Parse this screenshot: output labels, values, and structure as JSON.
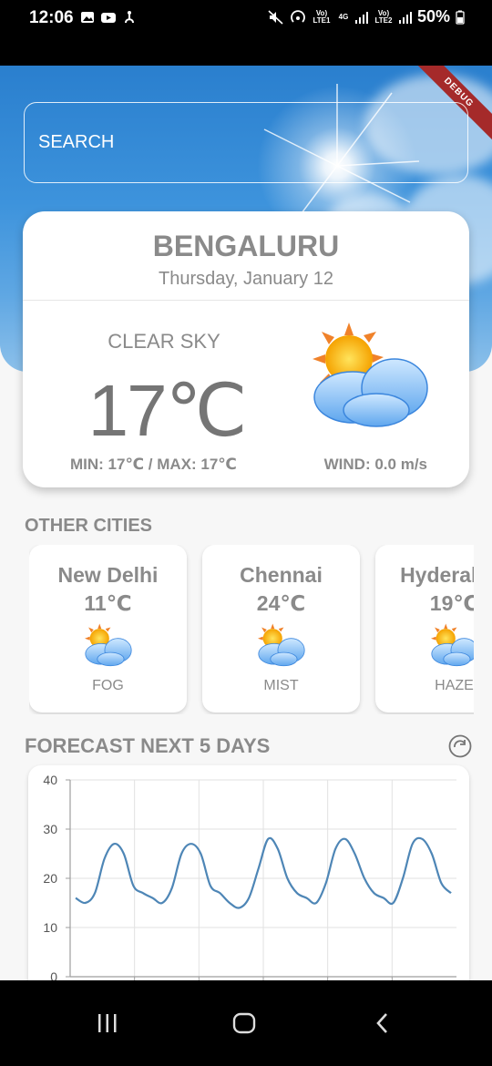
{
  "status_bar": {
    "time": "12:06",
    "battery": "50%",
    "network_1": "Vo) LTE1",
    "network_type": "4G",
    "network_2": "Vo) LTE2"
  },
  "debug_banner": "DEBUG",
  "search": {
    "placeholder": "SEARCH"
  },
  "current": {
    "city": "BENGALURU",
    "date": "Thursday, January 12",
    "condition": "CLEAR SKY",
    "temperature": "17℃",
    "min_max": "MIN: 17℃ / MAX: 17℃",
    "wind": "WIND: 0.0 m/s",
    "icon": "partly-cloudy-icon"
  },
  "other_cities": {
    "title": "OTHER CITIES",
    "items": [
      {
        "name": "New Delhi",
        "temp": "11℃",
        "condition": "FOG",
        "icon": "partly-cloudy-icon"
      },
      {
        "name": "Chennai",
        "temp": "24℃",
        "condition": "MIST",
        "icon": "partly-cloudy-icon"
      },
      {
        "name": "Hyderabad",
        "temp": "19℃",
        "condition": "HAZE",
        "icon": "partly-cloudy-icon"
      }
    ]
  },
  "forecast": {
    "title": "FORECAST NEXT 5 DAYS",
    "refresh_icon": "refresh-icon"
  },
  "chart_data": {
    "type": "line",
    "title": "",
    "xlabel": "",
    "ylabel": "",
    "ylim": [
      0,
      40
    ],
    "yticks": [
      "0",
      "10",
      "20",
      "30",
      "40"
    ],
    "grid": true,
    "series": [
      {
        "values": [
          16,
          15,
          17,
          24,
          27,
          25,
          18.5,
          17,
          16,
          15,
          18,
          25,
          27,
          25,
          18.5,
          17,
          15,
          14,
          16,
          22,
          28,
          26,
          20,
          17,
          16,
          15,
          19,
          26,
          28,
          25,
          20,
          17,
          16,
          15,
          20,
          27,
          28,
          25,
          19,
          17
        ]
      }
    ],
    "line_color": "#4e86b6"
  },
  "nav": {
    "recents_icon": "recents-icon",
    "home_icon": "home-icon",
    "back_icon": "back-icon"
  },
  "colors": {
    "text_gray": "#8a8a8a",
    "sky_blue": "#3d93dc",
    "debug_red": "#a52a2a"
  }
}
